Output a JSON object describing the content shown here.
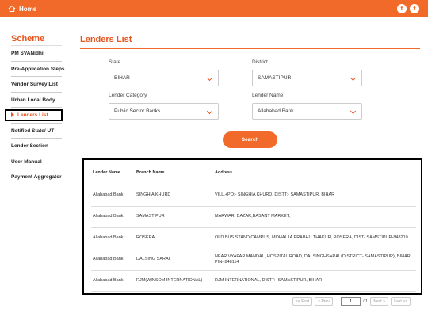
{
  "topbar": {
    "home_label": "Home",
    "social": [
      {
        "icon": "facebook-icon",
        "glyph": "f"
      },
      {
        "icon": "twitter-icon",
        "glyph": "t"
      }
    ]
  },
  "sidebar": {
    "title": "Scheme",
    "items": [
      {
        "label": "PM SVANidhi"
      },
      {
        "label": "Pre-Application Steps"
      },
      {
        "label": "Vendor Survey List"
      },
      {
        "label": "Urban Local Body"
      },
      {
        "label": "Lenders List",
        "active": true
      },
      {
        "label": "Notified State/ UT"
      },
      {
        "label": "Lender Section"
      },
      {
        "label": "User Manual"
      },
      {
        "label": "Payment Aggregator"
      }
    ]
  },
  "main": {
    "title": "Lenders List",
    "filters": {
      "state_label": "State",
      "state_value": "BIHAR",
      "district_label": "District",
      "district_value": "SAMASTIPUR",
      "category_label": "Lender Category",
      "category_value": "Public Sector Banks",
      "lender_label": "Lender Name",
      "lender_value": "Allahabad Bank"
    },
    "search_label": "Search"
  },
  "table": {
    "headers": [
      "Lender Name",
      "Branch Name",
      "Address"
    ],
    "rows": [
      [
        "Allahabad Bank",
        "SINGHIA KHURD",
        "VILL.+PO:- SINGHIA KHURD, DISTT:- SAMASTIPUR, BIHAR"
      ],
      [
        "Allahabad Bank",
        "SAMASTIPUR",
        "MARWARI BAZAR,BASANT MARKET,"
      ],
      [
        "Allahabad Bank",
        "ROSERA",
        "OLD BUS STAND CAMPUS, MOHALLA PRABHU THAKUR, ROSERA, DIST- SAMSTIPUR-848210"
      ],
      [
        "Allahabad Bank",
        "DALSING SARAI",
        "NEAR VYAPAR MANDAL, HOSPITAL ROAD, DALSINGHSARAI (DISTRICT- SAMASTIPUR), BIHAR, PIN- 848114"
      ],
      [
        "Allahabad Bank",
        "RJM(WINSOM INTERNATIONAL)",
        "RJM INTERNATIONAL, DISTT:- SAMASTIPUR, BIHAR"
      ]
    ]
  },
  "pagination": {
    "first": "<< First",
    "prev": "< Prev",
    "current_page": "1",
    "of_text": "/ 1",
    "next": "Next >",
    "last": "Last >>"
  },
  "colors": {
    "accent": "#f26a2a",
    "accent_text": "#e8541e"
  }
}
